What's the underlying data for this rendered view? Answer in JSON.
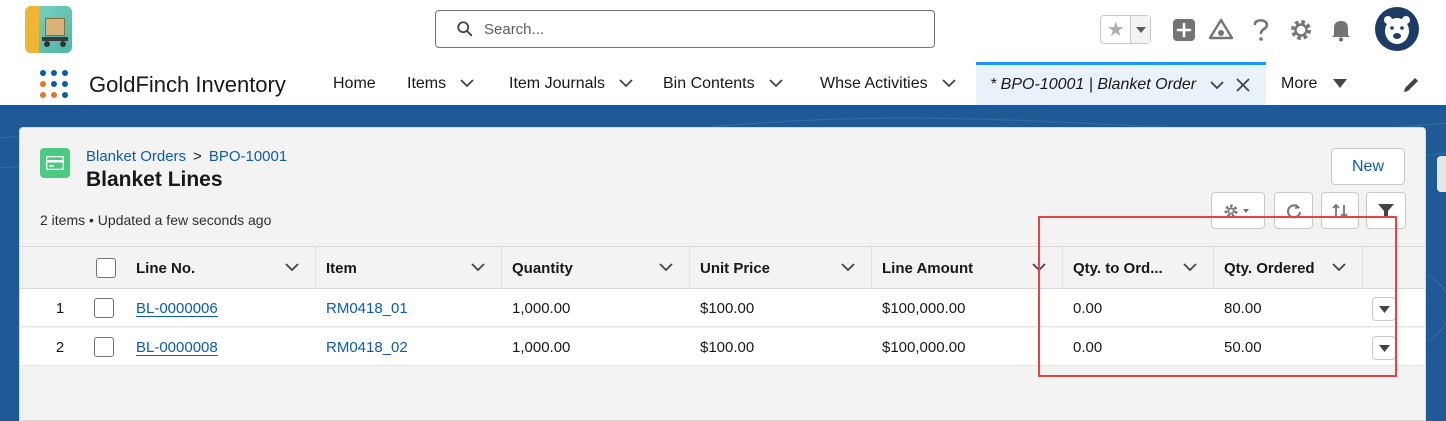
{
  "header": {
    "logo_icon": "goldfinch-app-logo",
    "search": {
      "placeholder": "Search..."
    },
    "icons": [
      "star-icon",
      "add-icon",
      "trailhead-icon",
      "help-icon",
      "settings-icon",
      "notifications-icon",
      "avatar-icon"
    ]
  },
  "nav": {
    "app_name": "GoldFinch Inventory",
    "items": [
      {
        "label": "Home"
      },
      {
        "label": "Items"
      },
      {
        "label": "Item Journals"
      },
      {
        "label": "Bin Contents"
      },
      {
        "label": "Whse Activities"
      }
    ],
    "active_tab": {
      "label": "* BPO-10001 | Blanket Order"
    },
    "more_label": "More"
  },
  "card": {
    "breadcrumb": {
      "parent": "Blanket Orders",
      "separator": ">",
      "record": "BPO-10001"
    },
    "title": "Blanket Lines",
    "status": "2 items • Updated a few seconds ago",
    "new_button": "New"
  },
  "table": {
    "columns": [
      "Line No.",
      "Item",
      "Quantity",
      "Unit Price",
      "Line Amount",
      "Qty. to Ord...",
      "Qty. Ordered"
    ],
    "rows": [
      {
        "index": "1",
        "line_no": "BL-0000006",
        "item": "RM0418_01",
        "quantity": "1,000.00",
        "unit_price": "$100.00",
        "line_amount": "$100,000.00",
        "qty_to_order": "0.00",
        "qty_ordered": "80.00"
      },
      {
        "index": "2",
        "line_no": "BL-0000008",
        "item": "RM0418_02",
        "quantity": "1,000.00",
        "unit_price": "$100.00",
        "line_amount": "$100,000.00",
        "qty_to_order": "0.00",
        "qty_ordered": "50.00"
      }
    ]
  },
  "colors": {
    "brand_blue": "#0b5cab",
    "workspace_blue": "#1f5a96",
    "highlight_red": "#e0463f",
    "record_icon_green": "#4bca81"
  }
}
